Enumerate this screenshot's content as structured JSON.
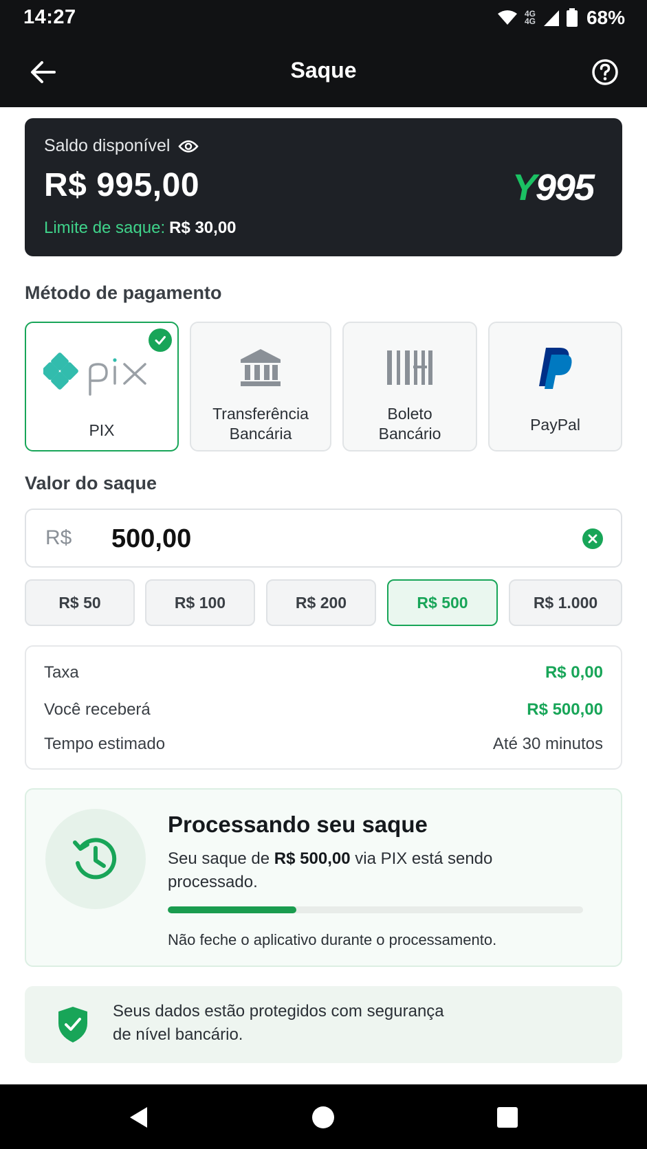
{
  "status_bar": {
    "time": "14:27",
    "network_top": "4G",
    "network_bottom": "4G",
    "battery": "68%"
  },
  "app_bar": {
    "title": "Saque",
    "back_icon": "arrow-left-icon",
    "help_icon": "question-circle-icon"
  },
  "balance": {
    "label": "Saldo disponível",
    "amount": "R$ 995,00",
    "limit_label": "Limite de saque:",
    "limit_value": "R$ 30,00",
    "brand_y": "Y",
    "brand_num": "995"
  },
  "payment": {
    "title": "Método de pagamento",
    "methods": [
      {
        "label": "PIX",
        "icon": "pix-logo",
        "selected": true
      },
      {
        "label_line1": "Transferência",
        "label_line2": "Bancária",
        "icon": "bank-icon",
        "selected": false
      },
      {
        "label_line1": "Boleto",
        "label_line2": "Bancário",
        "icon": "barcode-icon",
        "selected": false
      },
      {
        "label": "PayPal",
        "icon": "paypal-logo",
        "selected": false
      }
    ]
  },
  "amount": {
    "title": "Valor do saque",
    "currency": "R$",
    "value": "500,00",
    "quick": [
      "R$ 50",
      "R$ 100",
      "R$ 200",
      "R$ 500",
      "R$ 1.000"
    ],
    "selected_quick": "R$ 500"
  },
  "summary": {
    "fee_label": "Taxa",
    "fee_value": "R$ 0,00",
    "receive_label": "Você receberá",
    "receive_value": "R$ 500,00",
    "time_label": "Tempo estimado",
    "time_value": "Até 30 minutos"
  },
  "processing": {
    "title": "Processando seu saque",
    "msg_prefix": "Seu saque de",
    "msg_amount": "R$ 500,00",
    "msg_suffix": "via PIX está sendo processado.",
    "progress": 0.31,
    "note": "Não feche o aplicativo durante o processamento."
  },
  "security": {
    "line1": "Seus dados estão protegidos com segurança",
    "line2": "de nível bancário."
  },
  "colors": {
    "accent": "#18a558",
    "dark_bg": "#111214",
    "card_bg": "#1e2126"
  }
}
